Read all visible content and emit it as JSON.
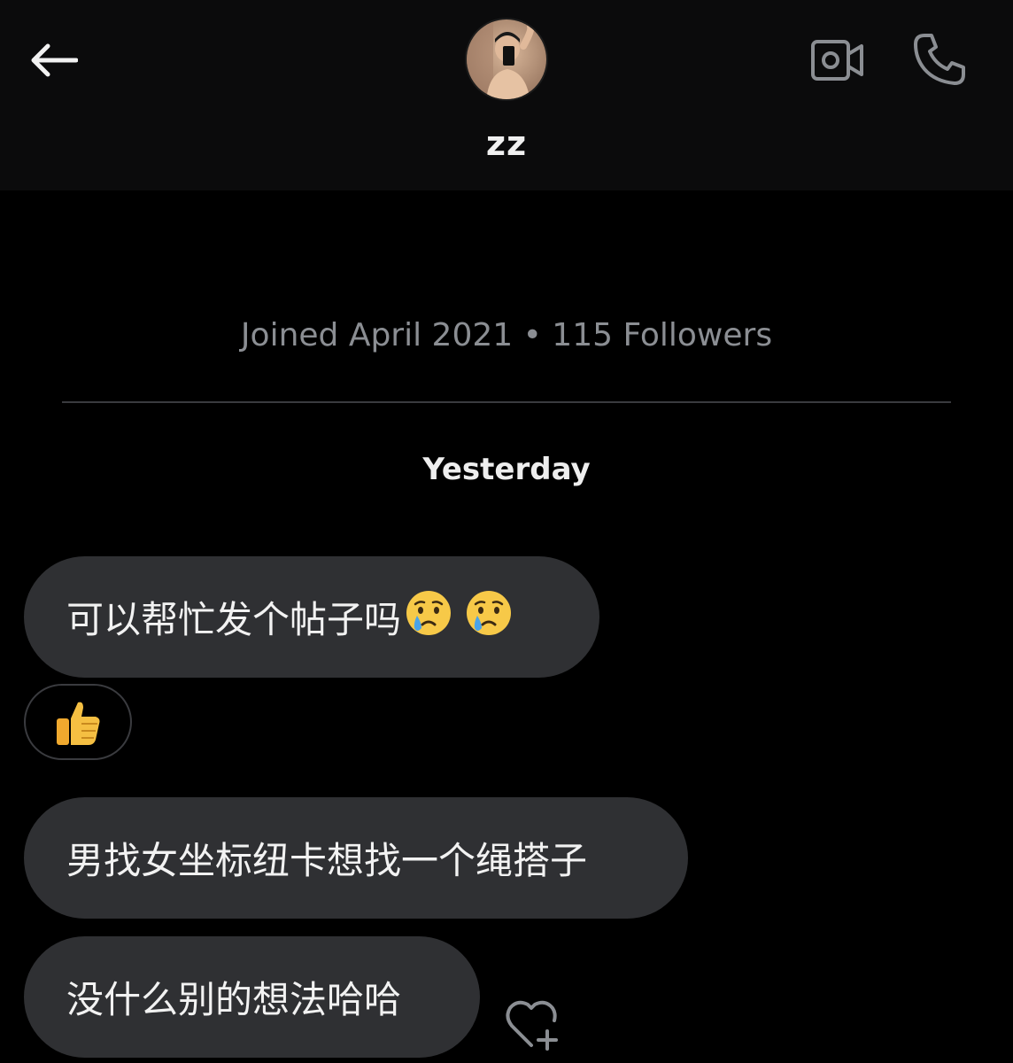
{
  "header": {
    "display_name": "zz"
  },
  "profile": {
    "meta": "Joined April 2021 • 115 Followers"
  },
  "conversation": {
    "date_separator": "Yesterday",
    "messages": [
      {
        "text": "可以帮忙发个帖子吗",
        "emojis": [
          "crying-face",
          "crying-face"
        ]
      },
      {
        "text": "男找女坐标纽卡想找一个绳搭子"
      },
      {
        "text": "没什么别的想法哈哈"
      }
    ],
    "reaction": "thumbs-up"
  },
  "icons": [
    "back-arrow-icon",
    "video-call-icon",
    "phone-icon",
    "heart-add-icon"
  ],
  "colors": {
    "background": "#000000",
    "header_bg": "#0b0b0c",
    "bubble_bg": "#2f3033",
    "muted_text": "#8b8e93",
    "text": "#f2f2f2"
  }
}
